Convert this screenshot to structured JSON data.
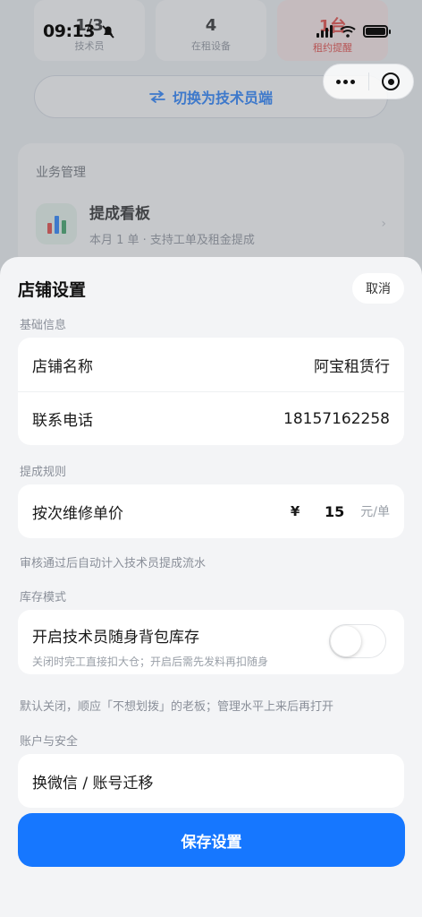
{
  "status_bar": {
    "time": "09:13"
  },
  "background": {
    "stats": [
      {
        "value": "1/3",
        "label": "技术员"
      },
      {
        "value": "4",
        "label": "在租设备"
      },
      {
        "value": "1台",
        "label": "租约提醒"
      }
    ],
    "switch_button": {
      "icon": "swap-arrows-icon",
      "label": "切换为技术员端"
    },
    "business": {
      "title": "业务管理",
      "item": {
        "name": "提成看板",
        "desc": "本月 1 单 · 支持工单及租金提成"
      }
    }
  },
  "sheet": {
    "title": "店铺设置",
    "cancel_label": "取消",
    "basic": {
      "label": "基础信息",
      "store_name": {
        "label": "店铺名称",
        "value": "阿宝租赁行"
      },
      "phone": {
        "label": "联系电话",
        "value": "18157162258"
      }
    },
    "commission": {
      "label": "提成规则",
      "repair_price": {
        "label": "按次维修单价",
        "currency": "¥",
        "value": "15",
        "unit": "元/单"
      },
      "hint": "审核通过后自动计入技术员提成流水"
    },
    "inventory": {
      "label": "库存模式",
      "toggle": {
        "title": "开启技术员随身背包库存",
        "sub": "关闭时完工直接扣大仓；开启后需先发料再扣随身",
        "on": false
      },
      "hint": "默认关闭，顺应「不想划拨」的老板；管理水平上来后再打开"
    },
    "account": {
      "label": "账户与安全",
      "item": "换微信 / 账号迁移"
    },
    "save_label": "保存设置"
  },
  "colors": {
    "accent": "#1677ff",
    "alert": "#e53935"
  }
}
